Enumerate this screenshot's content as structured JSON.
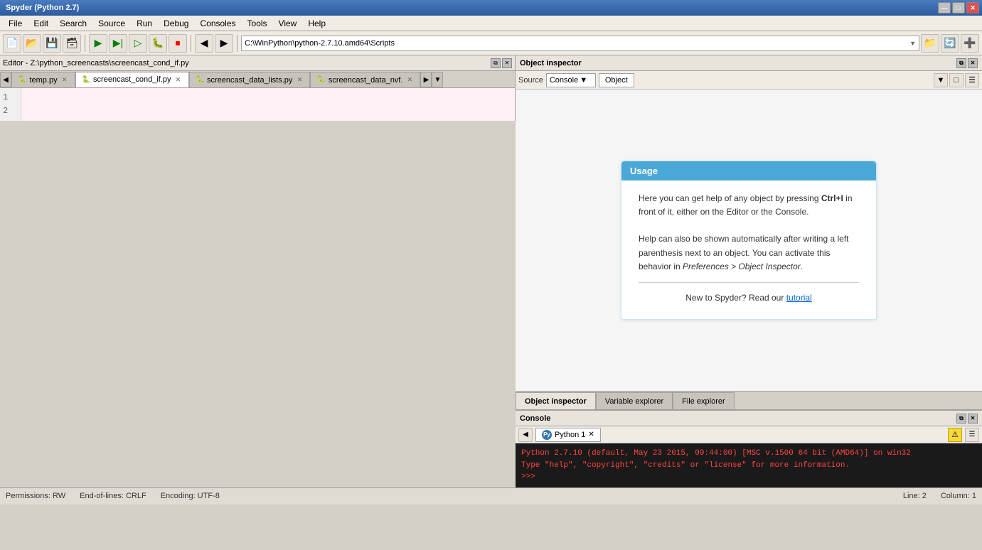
{
  "window": {
    "title": "Spyder (Python 2.7)"
  },
  "titlebar": {
    "title": "Spyder (Python 2.7)",
    "min_btn": "—",
    "max_btn": "□",
    "close_btn": "✕"
  },
  "menubar": {
    "items": [
      "File",
      "Edit",
      "Search",
      "Source",
      "Run",
      "Debug",
      "Consoles",
      "Tools",
      "View",
      "Help"
    ]
  },
  "toolbar": {
    "path": "C:\\WinPython\\python-2.7.10.amd64\\Scripts"
  },
  "editor": {
    "header_title": "Editor - Z:\\python_screencasts\\screencast_cond_if.py",
    "tabs": [
      {
        "label": "temp.py",
        "active": false,
        "icon": "🐍"
      },
      {
        "label": "screencast_cond_if.py",
        "active": true,
        "icon": "🐍"
      },
      {
        "label": "screencast_data_lists.py",
        "active": false,
        "icon": "🐍"
      },
      {
        "label": "screencast_data_nvf.",
        "active": false,
        "icon": "🐍"
      }
    ],
    "line_numbers": [
      "1",
      "2"
    ],
    "code_lines": [
      "",
      ""
    ]
  },
  "object_inspector": {
    "title": "Object inspector",
    "source_label": "Source",
    "console_dropdown": "Console",
    "object_btn": "Object",
    "usage": {
      "title": "Usage",
      "para1": "Here you can get help of any object by pressing ",
      "bold1": "Ctrl+I",
      "para1b": " in front of it, either on the Editor or the Console.",
      "para2": "Help can also be shown automatically after writing a left parenthesis next to an object. You can activate this behavior in ",
      "italic1": "Preferences > Object Inspector",
      "para2b": ".",
      "footer_pre": "New to Spyder? Read our ",
      "tutorial_link": "tutorial"
    }
  },
  "bottom_tabs": [
    {
      "label": "Object inspector",
      "active": true
    },
    {
      "label": "Variable explorer",
      "active": false
    },
    {
      "label": "File explorer",
      "active": false
    }
  ],
  "console": {
    "header_title": "Console",
    "tab_label": "Python 1",
    "output_lines": [
      "Python 2.7.10 (default, May 23 2015, 09:44:00) [MSC v.1500 64 bit (AMD64)] on win32",
      "Type \"help\", \"copyright\", \"credits\" or \"license\" for more information.",
      ">>>"
    ]
  },
  "statusbar": {
    "permissions": "Permissions: RW",
    "eol": "End-of-lines: CRLF",
    "encoding": "Encoding: UTF-8",
    "line": "Line: 2",
    "column": "Column: 1"
  },
  "icons": {
    "new_file": "📄",
    "open": "📂",
    "save": "💾",
    "save_all": "💾",
    "run": "▶",
    "run_file": "▶▶",
    "debug": "🐛",
    "back": "◀",
    "forward": "▶",
    "chevron_down": "▼",
    "maximize": "□",
    "restore": "❐",
    "close": "✕",
    "warning": "⚠",
    "list": "☰"
  }
}
